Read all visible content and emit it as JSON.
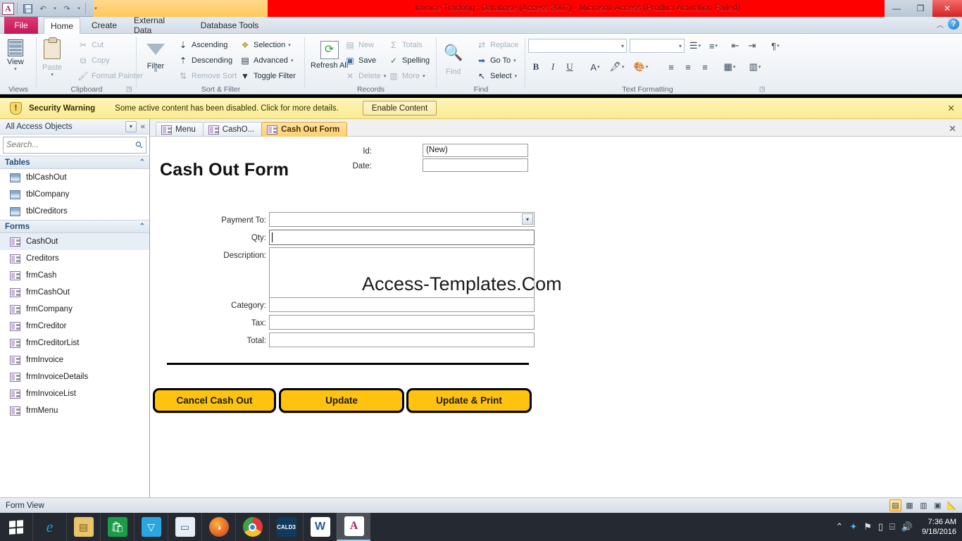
{
  "window": {
    "title": "Invoice Tracking : Database (Access 2007) - Microsoft Access (Product Activation Failed)",
    "app_logo": "A",
    "minimize": "—",
    "restore": "❐",
    "close": "✕",
    "ribbon_collapse": "︿",
    "help": "?"
  },
  "quick_access": {
    "save": "save-icon",
    "undo": "↶",
    "redo": "↷",
    "customize": "▾"
  },
  "ribbon": {
    "tabs": [
      {
        "label": "File",
        "active": false
      },
      {
        "label": "Home",
        "active": true
      },
      {
        "label": "Create",
        "active": false
      },
      {
        "label": "External Data",
        "active": false
      },
      {
        "label": "Database Tools",
        "active": false
      }
    ],
    "groups": [
      {
        "name": "Views",
        "label": "Views",
        "big_buttons": [
          {
            "label": "View",
            "icon": "datasheet-icon",
            "has_menu": true
          }
        ],
        "small_buttons": []
      },
      {
        "name": "Clipboard",
        "label": "Clipboard",
        "big_buttons": [
          {
            "label": "Paste",
            "icon": "clipboard-icon",
            "has_menu": true,
            "disabled": true
          }
        ],
        "small_buttons": [
          {
            "label": "Cut",
            "icon": "scissors-icon",
            "disabled": true
          },
          {
            "label": "Copy",
            "icon": "copy-icon",
            "disabled": true
          },
          {
            "label": "Format Painter",
            "icon": "paintbrush-icon",
            "disabled": true
          }
        ],
        "has_dialog_launcher": true
      },
      {
        "name": "Sort & Filter",
        "label": "Sort & Filter",
        "big_buttons": [
          {
            "label": "Filter",
            "icon": "funnel-icon",
            "has_menu": false
          }
        ],
        "small_buttons": [
          {
            "label": "Ascending",
            "icon": "sort-asc-icon",
            "disabled": false
          },
          {
            "label": "Descending",
            "icon": "sort-desc-icon",
            "disabled": false
          },
          {
            "label": "Remove Sort",
            "icon": "remove-sort-icon",
            "disabled": true
          },
          {
            "label": "Selection",
            "icon": "selection-icon",
            "disabled": false,
            "has_menu": true
          },
          {
            "label": "Advanced",
            "icon": "advanced-icon",
            "disabled": false,
            "has_menu": true
          },
          {
            "label": "Toggle Filter",
            "icon": "toggle-filter-icon",
            "disabled": false
          }
        ]
      },
      {
        "name": "Records",
        "label": "Records",
        "big_buttons": [
          {
            "label": "Refresh All",
            "icon": "refresh-icon",
            "has_menu": true
          }
        ],
        "small_buttons": [
          {
            "label": "New",
            "icon": "new-record-icon",
            "disabled": true
          },
          {
            "label": "Save",
            "icon": "save-record-icon",
            "disabled": false
          },
          {
            "label": "Delete",
            "icon": "delete-icon",
            "disabled": true,
            "has_menu": true
          },
          {
            "label": "Totals",
            "icon": "sigma-icon",
            "disabled": true
          },
          {
            "label": "Spelling",
            "icon": "spelling-icon",
            "disabled": false
          },
          {
            "label": "More",
            "icon": "more-icon",
            "disabled": true,
            "has_menu": true
          }
        ]
      },
      {
        "name": "Find",
        "label": "Find",
        "big_buttons": [
          {
            "label": "Find",
            "icon": "binoculars-icon",
            "disabled": true
          }
        ],
        "small_buttons": [
          {
            "label": "Replace",
            "icon": "replace-icon",
            "disabled": true
          },
          {
            "label": "Go To",
            "icon": "goto-icon",
            "disabled": false,
            "has_menu": true
          },
          {
            "label": "Select",
            "icon": "select-icon",
            "disabled": false,
            "has_menu": true
          }
        ]
      },
      {
        "name": "Text Formatting",
        "label": "Text Formatting",
        "font_name": "",
        "font_size": "",
        "has_dialog_launcher": true,
        "controls": [
          "bullets-icon",
          "numbering-icon",
          "decrease-indent-icon",
          "increase-indent-icon",
          "text-direction-icon",
          "bold-icon",
          "italic-icon",
          "underline-icon",
          "font-color-icon",
          "text-highlight-icon",
          "background-color-icon",
          "align-left-icon",
          "align-center-icon",
          "align-right-icon",
          "gridlines-icon",
          "alternate-row-color-icon"
        ]
      }
    ]
  },
  "security_bar": {
    "icon": "warning-shield-icon",
    "title": "Security Warning",
    "message": "Some active content has been disabled. Click for more details.",
    "button": "Enable Content",
    "close": "✕"
  },
  "nav_pane": {
    "header": "All Access Objects",
    "menu_icon": "dropdown-icon",
    "collapse_icon": "«",
    "search_placeholder": "Search...",
    "search_value": "",
    "search_icon": "search-icon",
    "groups": [
      {
        "label": "Tables",
        "chevron": "⌃",
        "items": [
          {
            "label": "tblCashOut",
            "icon": "table-icon",
            "selected": false
          },
          {
            "label": "tblCompany",
            "icon": "table-icon",
            "selected": false
          },
          {
            "label": "tblCreditors",
            "icon": "table-icon",
            "selected": false
          }
        ]
      },
      {
        "label": "Forms",
        "chevron": "⌃",
        "items": [
          {
            "label": "CashOut",
            "icon": "form-icon",
            "selected": true
          },
          {
            "label": "Creditors",
            "icon": "form-icon",
            "selected": false
          },
          {
            "label": "frmCash",
            "icon": "form-icon",
            "selected": false
          },
          {
            "label": "frmCashOut",
            "icon": "form-icon",
            "selected": false
          },
          {
            "label": "frmCompany",
            "icon": "form-icon",
            "selected": false
          },
          {
            "label": "frmCreditor",
            "icon": "form-icon",
            "selected": false
          },
          {
            "label": "frmCreditorList",
            "icon": "form-icon",
            "selected": false
          },
          {
            "label": "frmInvoice",
            "icon": "form-icon",
            "selected": false
          },
          {
            "label": "frmInvoiceDetails",
            "icon": "form-icon",
            "selected": false
          },
          {
            "label": "frmInvoiceList",
            "icon": "form-icon",
            "selected": false
          },
          {
            "label": "frmMenu",
            "icon": "form-icon",
            "selected": false
          }
        ]
      }
    ]
  },
  "document": {
    "tabs": [
      {
        "label": "Menu",
        "icon": "form-icon",
        "active": false
      },
      {
        "label": "CashO...",
        "icon": "form-icon",
        "active": false
      },
      {
        "label": "Cash Out Form",
        "icon": "form-icon",
        "active": true
      }
    ],
    "close_icon": "✕"
  },
  "form": {
    "title": "Cash Out Form",
    "watermark": "Access-Templates.Com",
    "header_fields": [
      {
        "label": "Id:",
        "value": "(New)",
        "type": "text"
      },
      {
        "label": "Date:",
        "value": "",
        "type": "text"
      }
    ],
    "fields": [
      {
        "label": "Payment To:",
        "value": "",
        "type": "combobox"
      },
      {
        "label": "Qty:",
        "value": "",
        "type": "text",
        "focused": true
      },
      {
        "label": "Description:",
        "value": "",
        "type": "textarea"
      },
      {
        "label": "Category:",
        "value": "",
        "type": "text"
      },
      {
        "label": "Tax:",
        "value": "",
        "type": "text"
      },
      {
        "label": "Total:",
        "value": "",
        "type": "text"
      }
    ],
    "buttons": [
      {
        "label": "Cancel Cash Out"
      },
      {
        "label": "Update"
      },
      {
        "label": "Update & Print"
      }
    ],
    "button_color": "#ffc20e"
  },
  "status_bar": {
    "text": "Form View",
    "view_buttons": [
      {
        "icon": "form-view-icon",
        "active": true
      },
      {
        "icon": "datasheet-view-icon",
        "active": false
      },
      {
        "icon": "pivottable-view-icon",
        "active": false
      },
      {
        "icon": "layout-view-icon",
        "active": false
      },
      {
        "icon": "design-view-icon",
        "active": false
      }
    ]
  },
  "taskbar": {
    "start": "windows-logo-icon",
    "items": [
      {
        "name": "internet-explorer-icon",
        "glyph": "e",
        "color": "#1e9bdc",
        "active": false
      },
      {
        "name": "file-explorer-icon",
        "glyph": "🗂",
        "color": "#e9c46a",
        "active": false
      },
      {
        "name": "windows-store-icon",
        "glyph": "🛍",
        "color": "#1a9c4a",
        "active": false
      },
      {
        "name": "app-icon",
        "glyph": "▽",
        "color": "#2aa7e0",
        "active": false
      },
      {
        "name": "lenovo-icon",
        "glyph": "🖥",
        "color": "#2d6fa8",
        "active": false
      },
      {
        "name": "firefox-icon",
        "glyph": "🦊",
        "color": "#e2662a",
        "active": false
      },
      {
        "name": "chrome-icon",
        "glyph": "◉",
        "color": "#3a8f3a",
        "active": false
      },
      {
        "name": "cald3-icon",
        "glyph": "CALD3",
        "color": "#123a5e",
        "active": false
      },
      {
        "name": "word-icon",
        "glyph": "W",
        "color": "#2b579a",
        "active": false
      },
      {
        "name": "access-icon",
        "glyph": "A",
        "color": "#a8215e",
        "active": true
      }
    ],
    "tray": [
      {
        "name": "show-hidden-icons-icon",
        "glyph": "⌃"
      },
      {
        "name": "bluetooth-icon",
        "glyph": "✦"
      },
      {
        "name": "action-center-icon",
        "glyph": "⚑"
      },
      {
        "name": "battery-icon",
        "glyph": "🔋"
      },
      {
        "name": "network-icon",
        "glyph": "🖧"
      },
      {
        "name": "volume-icon",
        "glyph": "🔊"
      }
    ],
    "time": "7:36 AM",
    "date": "9/18/2016"
  }
}
